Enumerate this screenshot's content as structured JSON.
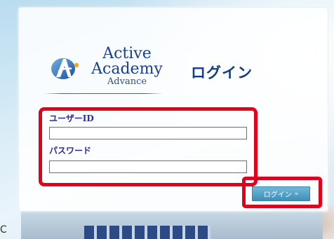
{
  "logo": {
    "line1": "Active",
    "line2": "Academy",
    "line3": "Advance"
  },
  "page": {
    "title": "ログイン"
  },
  "form": {
    "user_id_label": "ユーザーID",
    "user_id_value": "",
    "password_label": "パスワード",
    "password_value": "",
    "login_button_label": "ログイン",
    "login_button_chevron": "»"
  },
  "edge": {
    "char": "C"
  },
  "colors": {
    "highlight": "#e3001b",
    "brand_blue": "#123c86",
    "button": "#4a9cc4",
    "label": "#2c2c9b"
  },
  "icons": {
    "logo_mark": "active-academy-logo-icon"
  }
}
